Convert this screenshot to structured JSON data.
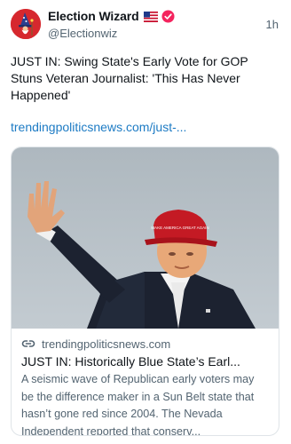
{
  "author": {
    "display_name": "Election Wizard",
    "handle": "@Electionwiz",
    "flag_icon": "us-flag-icon",
    "verified_icon": "verified-badge-icon",
    "verified_color": "#f4245e"
  },
  "post": {
    "time": "1h",
    "text": "JUST IN: Swing State's Early Vote for GOP Stuns Veteran Journalist: 'This Has Never Happened'",
    "link_text": "trendingpoliticsnews.com/just-..."
  },
  "card": {
    "hat_text": "MAKE AMERICA GREAT AGAIN",
    "domain": "trendingpoliticsnews.com",
    "title": "JUST IN: Historically Blue State’s Earl...",
    "description": "A seismic wave of Republican early voters may be the difference maker in a Sun Belt state that hasn’t gone red since 2004. The Nevada Independent reported that conserv..."
  },
  "colors": {
    "link": "#1d7bc4",
    "avatar_background": "#d6282e",
    "secondary_text": "#536471"
  }
}
